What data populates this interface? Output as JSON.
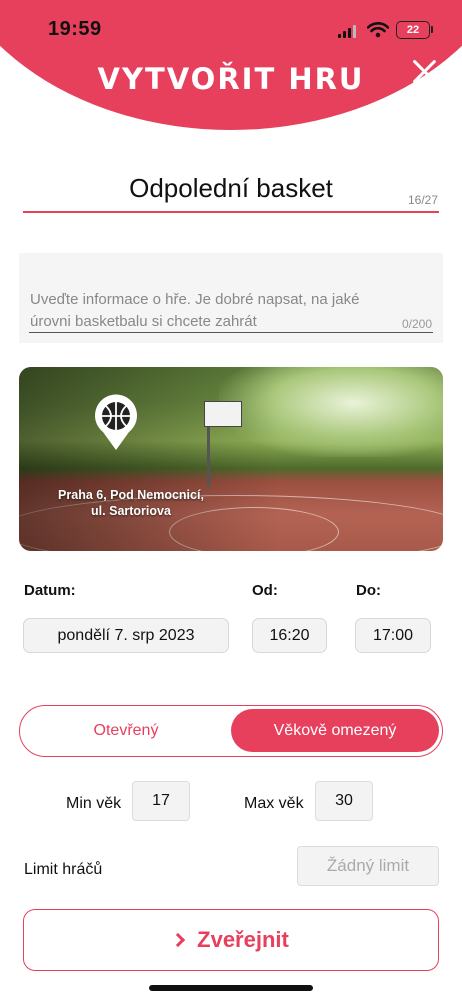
{
  "status_bar": {
    "time": "19:59",
    "battery": "22"
  },
  "header": {
    "title": "VYTVOŘIT HRU",
    "close_icon": "close-icon"
  },
  "game_name": {
    "value": "Odpolední basket",
    "counter": "16/27"
  },
  "description": {
    "placeholder": "Uveďte informace o hře. Je dobré napsat, na jaké úrovni basketbalu si chcete zahrát",
    "counter": "0/200"
  },
  "location": {
    "line1": "Praha 6, Pod Nemocnicí,",
    "line2": "ul. Sartoriova",
    "icon": "basketball-pin-icon"
  },
  "schedule": {
    "date_label": "Datum:",
    "date_value": "pondělí 7. srp 2023",
    "from_label": "Od:",
    "from_value": "16:20",
    "to_label": "Do:",
    "to_value": "17:00"
  },
  "access": {
    "options": [
      "Otevřený",
      "Věkově omezený"
    ],
    "selected": "Věkově omezený"
  },
  "age": {
    "min_label": "Min věk",
    "min_value": "17",
    "max_label": "Max věk",
    "max_value": "30"
  },
  "players": {
    "label": "Limit hráčů",
    "placeholder": "Žádný limit"
  },
  "publish": {
    "label": "Zveřejnit",
    "icon": "chevron-right-icon"
  },
  "colors": {
    "accent": "#e6405c"
  }
}
